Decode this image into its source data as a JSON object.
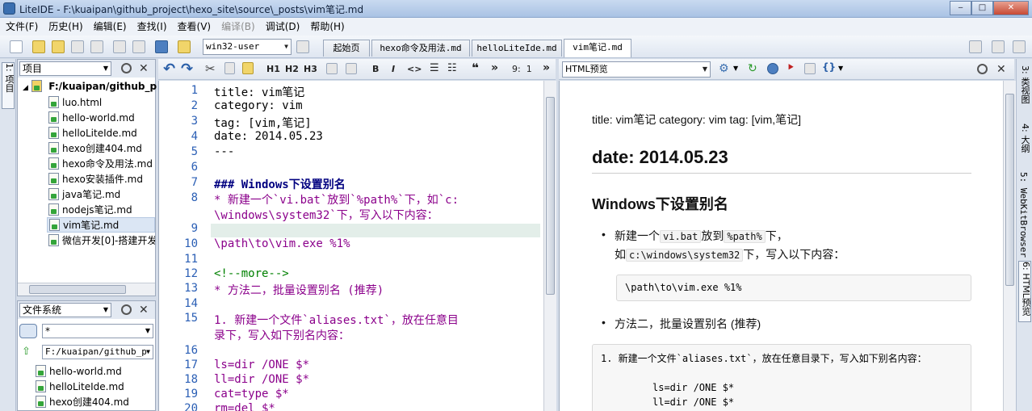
{
  "window": {
    "title": "LiteIDE - F:\\kuaipan\\github_project\\hexo_site\\source\\_posts\\vim笔记.md",
    "min": "‒",
    "max": "□",
    "close": "✕"
  },
  "menu": [
    "文件(F)",
    "历史(H)",
    "编辑(E)",
    "查找(I)",
    "查看(V)",
    "编译(B)",
    "调试(D)",
    "帮助(H)"
  ],
  "toolbar": {
    "build_config": "win32-user",
    "doc_tabs": [
      "起始页",
      "hexo命令及用法.md",
      "helloLiteIde.md",
      "vim笔记.md"
    ],
    "active_tab": "vim笔记.md"
  },
  "left_dock": {
    "tab_label": "1: 项目"
  },
  "project_panel": {
    "combo": "项目",
    "root": "F:/kuaipan/github_p",
    "files": [
      "luo.html",
      "hello-world.md",
      "helloLiteIde.md",
      "hexo创建404.md",
      "hexo命令及用法.md",
      "hexo安装插件.md",
      "java笔记.md",
      "nodejs笔记.md",
      "vim笔记.md",
      "微信开发[0]-搭建开发"
    ],
    "selected": "vim笔记.md"
  },
  "fs_panel": {
    "combo": "文件系统",
    "filter": "*",
    "path": "F:/kuaipan/github_p",
    "files": [
      "hello-world.md",
      "helloLiteIde.md",
      "hexo创建404.md"
    ]
  },
  "editor_toolbar": {
    "h1": "H1",
    "h2": "H2",
    "h3": "H3",
    "bold": "B",
    "italic": "I",
    "code": "<>",
    "quote": "❝",
    "more": "»",
    "cursor": "9:  1"
  },
  "editor": {
    "line_numbers": [
      "1",
      "2",
      "3",
      "4",
      "5",
      "6",
      "7",
      "8",
      "",
      "9",
      "10",
      "11",
      "12",
      "13",
      "14",
      "15",
      "",
      "16",
      "17",
      "18",
      "19",
      "20"
    ],
    "lines": [
      "title: vim笔记",
      "category: vim",
      "tag: [vim,笔记]",
      "date: 2014.05.23",
      "---",
      "",
      "### Windows下设置别名",
      "* 新建一个`vi.bat`放到`%path%`下，如`c:",
      "\\windows\\system32`下，写入以下内容：",
      "",
      "        \\path\\to\\vim.exe %1%",
      "",
      "<!--more-->",
      "* 方法二，批量设置别名  (推荐)",
      "",
      "    1. 新建一个文件`aliases.txt`，放在任意目",
      "录下，写入如下别名内容：",
      "",
      "            ls=dir /ONE $*",
      "            ll=dir /ONE $*",
      "            cat=type $*",
      "            rm=del $*"
    ]
  },
  "preview_toolbar": {
    "combo": "HTML预览"
  },
  "preview": {
    "front_matter": "title: vim笔记 category: vim tag: [vim,笔记]",
    "h2": "date: 2014.05.23",
    "h3": "Windows下设置别名",
    "b1_a": "新建一个",
    "b1_code1": "vi.bat",
    "b1_b": "放到",
    "b1_code2": "%path%",
    "b1_c": "下，",
    "b1_d": "如",
    "b1_code3": "c:\\windows\\system32",
    "b1_e": "下，写入以下内容：",
    "pre1": "\\path\\to\\vim.exe %1%",
    "b2": "方法二，批量设置别名 (推荐)",
    "pre2": [
      "1. 新建一个文件`aliases.txt`，放在任意目录下，写入如下别名内容：",
      "ls=dir /ONE $*",
      "ll=dir /ONE $*"
    ]
  },
  "right_dock": [
    "3: 类视图",
    "4: 大纲",
    "5: WebKitBrowser",
    "6: HTML预览"
  ]
}
